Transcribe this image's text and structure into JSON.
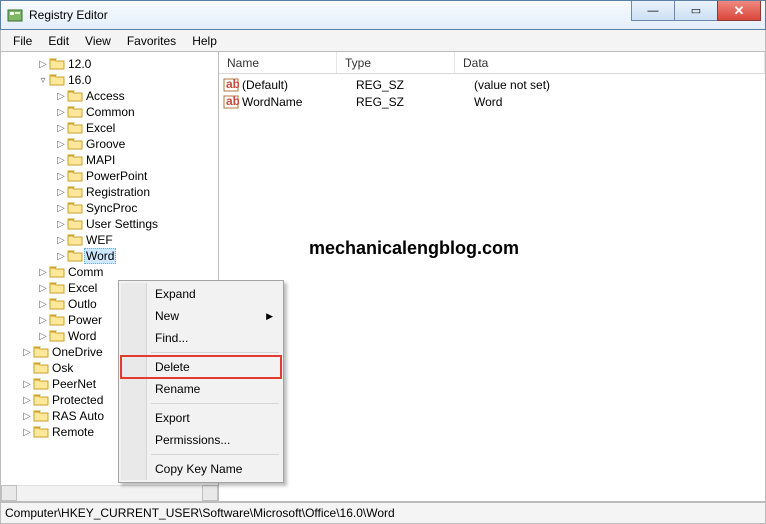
{
  "window": {
    "title": "Registry Editor"
  },
  "menu": {
    "file": "File",
    "edit": "Edit",
    "view": "View",
    "favorites": "Favorites",
    "help": "Help"
  },
  "tree": [
    {
      "indent": 36,
      "exp": "▷",
      "label": "12.0"
    },
    {
      "indent": 36,
      "exp": "▿",
      "label": "16.0"
    },
    {
      "indent": 54,
      "exp": "▷",
      "label": "Access"
    },
    {
      "indent": 54,
      "exp": "▷",
      "label": "Common"
    },
    {
      "indent": 54,
      "exp": "▷",
      "label": "Excel"
    },
    {
      "indent": 54,
      "exp": "▷",
      "label": "Groove"
    },
    {
      "indent": 54,
      "exp": "▷",
      "label": "MAPI"
    },
    {
      "indent": 54,
      "exp": "▷",
      "label": "PowerPoint"
    },
    {
      "indent": 54,
      "exp": "▷",
      "label": "Registration"
    },
    {
      "indent": 54,
      "exp": "▷",
      "label": "SyncProc"
    },
    {
      "indent": 54,
      "exp": "▷",
      "label": "User Settings"
    },
    {
      "indent": 54,
      "exp": "▷",
      "label": "WEF"
    },
    {
      "indent": 54,
      "exp": "▷",
      "label": "Word",
      "selected": true
    },
    {
      "indent": 36,
      "exp": "▷",
      "label": "Comm"
    },
    {
      "indent": 36,
      "exp": "▷",
      "label": "Excel"
    },
    {
      "indent": 36,
      "exp": "▷",
      "label": "Outlo"
    },
    {
      "indent": 36,
      "exp": "▷",
      "label": "Power"
    },
    {
      "indent": 36,
      "exp": "▷",
      "label": "Word"
    },
    {
      "indent": 20,
      "exp": "▷",
      "label": "OneDrive"
    },
    {
      "indent": 20,
      "exp": "",
      "label": "Osk"
    },
    {
      "indent": 20,
      "exp": "▷",
      "label": "PeerNet"
    },
    {
      "indent": 20,
      "exp": "▷",
      "label": "Protected"
    },
    {
      "indent": 20,
      "exp": "▷",
      "label": "RAS Auto"
    },
    {
      "indent": 20,
      "exp": "▷",
      "label": "Remote"
    }
  ],
  "columns": {
    "name": "Name",
    "type": "Type",
    "data": "Data"
  },
  "rows": [
    {
      "name": "(Default)",
      "type": "REG_SZ",
      "data": "(value not set)"
    },
    {
      "name": "WordName",
      "type": "REG_SZ",
      "data": "Word"
    }
  ],
  "context_menu": {
    "expand": "Expand",
    "new": "New",
    "find": "Find...",
    "delete": "Delete",
    "rename": "Rename",
    "export": "Export",
    "permissions": "Permissions...",
    "copy": "Copy Key Name"
  },
  "watermark": "mechanicalengblog.com",
  "status": "Computer\\HKEY_CURRENT_USER\\Software\\Microsoft\\Office\\16.0\\Word"
}
